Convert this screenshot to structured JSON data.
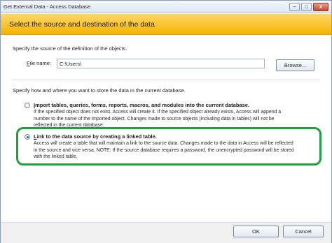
{
  "window": {
    "title": "Get External Data - Access Database",
    "minimize_glyph": "–",
    "maximize_glyph": "□",
    "close_glyph": "x"
  },
  "banner": {
    "text": "Select the source and destination of the data"
  },
  "source": {
    "label": "Specify the source of the definition of the objects.",
    "file_name_label_accesskey": "F",
    "file_name_label_rest": "ile name:",
    "file_name_value": "C:\\Users\\",
    "browse_label": "Browse..."
  },
  "store": {
    "label": "Specify how and where you want to store the data in the current database."
  },
  "options": [
    {
      "title_accesskey": "I",
      "title_rest": "mport tables, queries, forms, reports, macros, and modules into the current database.",
      "selected": false,
      "description_lines": [
        "If the specified object does not exist, Access will create it. If the specified object already exists, Access will append a",
        "number to the name of the imported object. Changes made to source objects (including data in tables) will not be",
        "reflected in the current database."
      ]
    },
    {
      "title_accesskey": "L",
      "title_rest": "ink to the data source by creating a linked table.",
      "selected": true,
      "description_lines": [
        "Access will create a table that will maintain a link to the source data. Changes made to the data in Access will be reflected",
        "in the source and vice versa. NOTE:  If the source database requires a password, the unencrypted password will be stored",
        "with the linked table."
      ]
    }
  ],
  "footer": {
    "ok_label": "OK",
    "cancel_label": "Cancel"
  },
  "colors": {
    "banner": "#f5b400",
    "highlight": "#1fa13e",
    "title_bar": "#dde7f3"
  }
}
